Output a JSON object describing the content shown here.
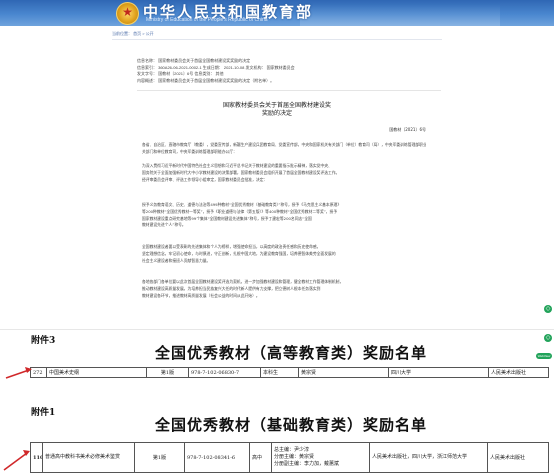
{
  "banner": {
    "title": "中华人民共和国教育部",
    "subtitle": "Ministry of Education of the People's Republic of China",
    "emblem_icon": "national-emblem"
  },
  "breadcrumb": "当前位置： 首页 > 公开",
  "meta": {
    "row1": "信息名称：  国家教材委员会关于首届全国教材建设奖奖励的决定",
    "row2": "信息索引：  360A26-06-2021-0002-1    生成日期：  2021-10-08    发文机构：  国家教材委员会",
    "row3": "发文字号：  国教材〔2021〕6号                    信息类别：  其他",
    "row4": "内容概述：  国家教材委员会关于首届全国教材建设奖奖励的决定（附名单）。"
  },
  "doc": {
    "title_line1": "国家教材委员会关于首届全国教材建设奖",
    "title_line2": "奖励的决定",
    "doc_number": "国教材〔2021〕6号",
    "salutation": "各省、自治区、直辖市教育厅（教委），党委宣传部，新疆生产建设兵团教育局、党委宣传部，中央和国家机关有关部门（单位）教育司（局），中央军委训练管理部职业教育局，",
    "salutation2": "关部门和单位教育司，中央军委训练管理部职能办公厅：",
    "para1": [
      "为深入贯彻习近平新时代中国特色社会主义思想和习近平总书记关于教材建设的重要指示批示精神，落实党中央、",
      "国务院关于全面加强新时代大中小学教材建设的决策部署，国家教材委员会组织开展了首届全国教材建设奖评选工作。",
      "经评审委员会评审、评选工作领导小组审定，国家教材委员会批准，决定："
    ],
    "para2": [
      "授予义务教育语文、历史、道德与法治等499种教材“全国优秀教材（基础教育类）”称号，授予《马克思主义基本原理》",
      "等200种教材“全国优秀教材一等奖”，授予《职业道德与法律（第五版）》等400种教材“全国优秀教材二等奖”，授予",
      "国家教材建设重点研究基地等99个集体“全国教材建设先进集体”称号，授予丁建宏等200名同志“全国",
      "教材建设先进个人”称号。"
    ],
    "para3": [
      "全国教材建设者要以受表彰的先进集体和个人为榜样，增强使命担当，以高度的政治责任感和历史使命感，",
      "坚定理想信念，牢记初心使命，与时俱进，守正创新，扎根中国大地，为建设教育强国，培养德智体美劳全面发展的",
      "社会主义建设者和接班人贡献智慧力量。"
    ],
    "para4": [
      "各地各部门各单位要以此次首届全国教材建设奖评选为契机，进一步加强教材建设和管理，健全教材工作管理体制机制，",
      "推动教材建设高质量发展，为培养担当民族复兴大任的时代新人提供有力支撑，把立德树人根本任务落实到",
      "教材建设各环节，推进教材高质量发展（社会公益的时间从此开始）。"
    ]
  },
  "side_badge_1": "◇",
  "side_badge_2": "◇",
  "side_pill": "WebView",
  "attachment3": {
    "label": "附件3",
    "title": "全国优秀教材（高等教育类）奖励名单",
    "row": {
      "index": "272",
      "name": "中国美术史纲",
      "edition": "第1版",
      "isbn": "978-7-102-06830-7",
      "level": "本科生",
      "author": "黄宗贤",
      "school": "四川大学",
      "publisher": "人民美术出版社"
    }
  },
  "attachment1": {
    "label": "附件1",
    "title": "全国优秀教材（基础教育类）奖励名单",
    "row": {
      "index": "110",
      "name": "普通高中教科书美术必修美术鉴赏",
      "edition": "第1版",
      "isbn": "978-7-102-08341-6",
      "stage": "高中",
      "editor_chief": "总主编：尹少淳",
      "editor_sub": "分册主编：黄宗贤",
      "editor_sub2": "分册副主编：李力加，戴蕙斌",
      "units": "人民美术出版社，四川大学，浙江师范大学",
      "publisher": "人民美术出版社"
    }
  },
  "colors": {
    "banner_blue": "#2f67b4",
    "arrow_red": "#d0282a",
    "badge_green": "#22a35a"
  }
}
